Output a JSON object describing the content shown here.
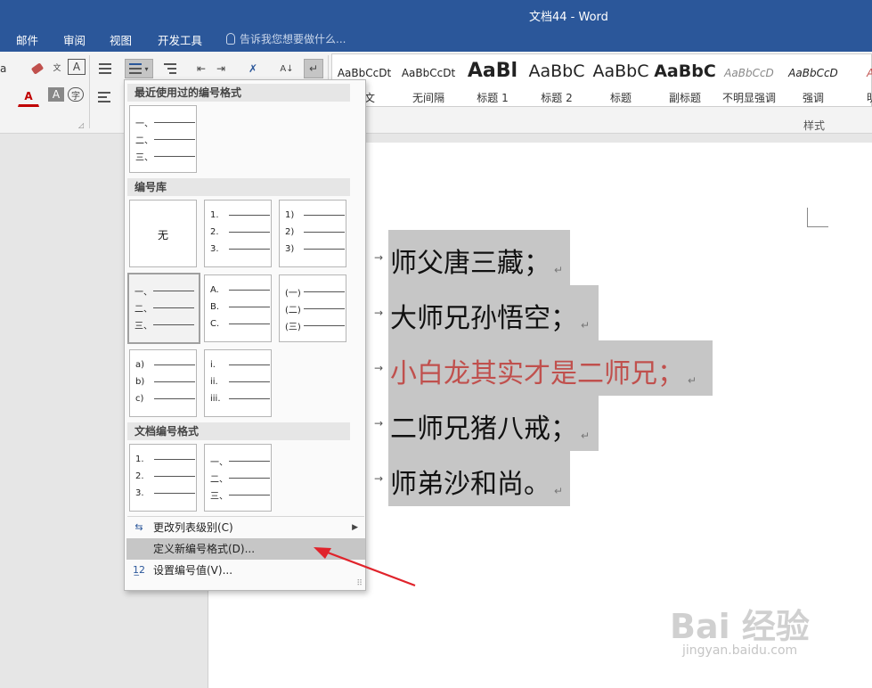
{
  "window": {
    "title": "文档44 - Word"
  },
  "tabs": [
    "邮件",
    "审阅",
    "视图",
    "开发工具"
  ],
  "tell_me": "告诉我您想要做什么...",
  "ribbon": {
    "left_labels": {
      "font_size_a": "a",
      "wen": "wén\n文",
      "A_box": "A",
      "A_red": "A",
      "A_shade": "A",
      "zi": "字"
    },
    "styles_gallery": [
      {
        "sample": "AaBbCcDt",
        "name": "正文"
      },
      {
        "sample": "AaBbCcDt",
        "name": "无间隔"
      },
      {
        "sample": "AaBl",
        "name": "标题 1"
      },
      {
        "sample": "AaBbC",
        "name": "标题 2"
      },
      {
        "sample": "AaBbC",
        "name": "标题"
      },
      {
        "sample": "AaBbC",
        "name": "副标题"
      },
      {
        "sample": "AaBbCcD",
        "name": "不明显强调"
      },
      {
        "sample": "AaBbCcD",
        "name": "强调"
      },
      {
        "sample": "AaB",
        "name": "明显"
      }
    ],
    "styles_group_label": "样式",
    "paragraph_mark_symbol": "↵"
  },
  "document": {
    "lines": [
      {
        "text": "师父唐三藏；",
        "color": "#111111"
      },
      {
        "text": "大师兄孙悟空；",
        "color": "#111111"
      },
      {
        "text": "小白龙其实才是二师兄；",
        "color": "#c0504d"
      },
      {
        "text": "二师兄猪八戒；",
        "color": "#111111"
      },
      {
        "text": "师弟沙和尚。",
        "color": "#111111"
      }
    ],
    "tab_arrow": "→",
    "para_mark": "↵"
  },
  "numbering_menu": {
    "recent_header": "最近使用过的编号格式",
    "library_header": "编号库",
    "document_header": "文档编号格式",
    "none_label": "无",
    "recent": [
      [
        "一、",
        "二、",
        "三、"
      ]
    ],
    "library": [
      [
        "1.",
        "2.",
        "3."
      ],
      [
        "1)",
        "2)",
        "3)"
      ],
      [
        "一、",
        "二、",
        "三、"
      ],
      [
        "A.",
        "B.",
        "C."
      ],
      [
        "(一)",
        "(二)",
        "(三)"
      ],
      [
        "a)",
        "b)",
        "c)"
      ],
      [
        "i.",
        "ii.",
        "iii."
      ]
    ],
    "document_formats": [
      [
        "1.",
        "2.",
        "3."
      ],
      [
        "一、",
        "二、",
        "三、"
      ]
    ],
    "items": {
      "change_level": "更改列表级别(C)",
      "define_new": "定义新编号格式(D)...",
      "set_value": "设置编号值(V)..."
    }
  },
  "watermark": {
    "logo": "Bai 经验",
    "sub": "jingyan.baidu.com"
  }
}
